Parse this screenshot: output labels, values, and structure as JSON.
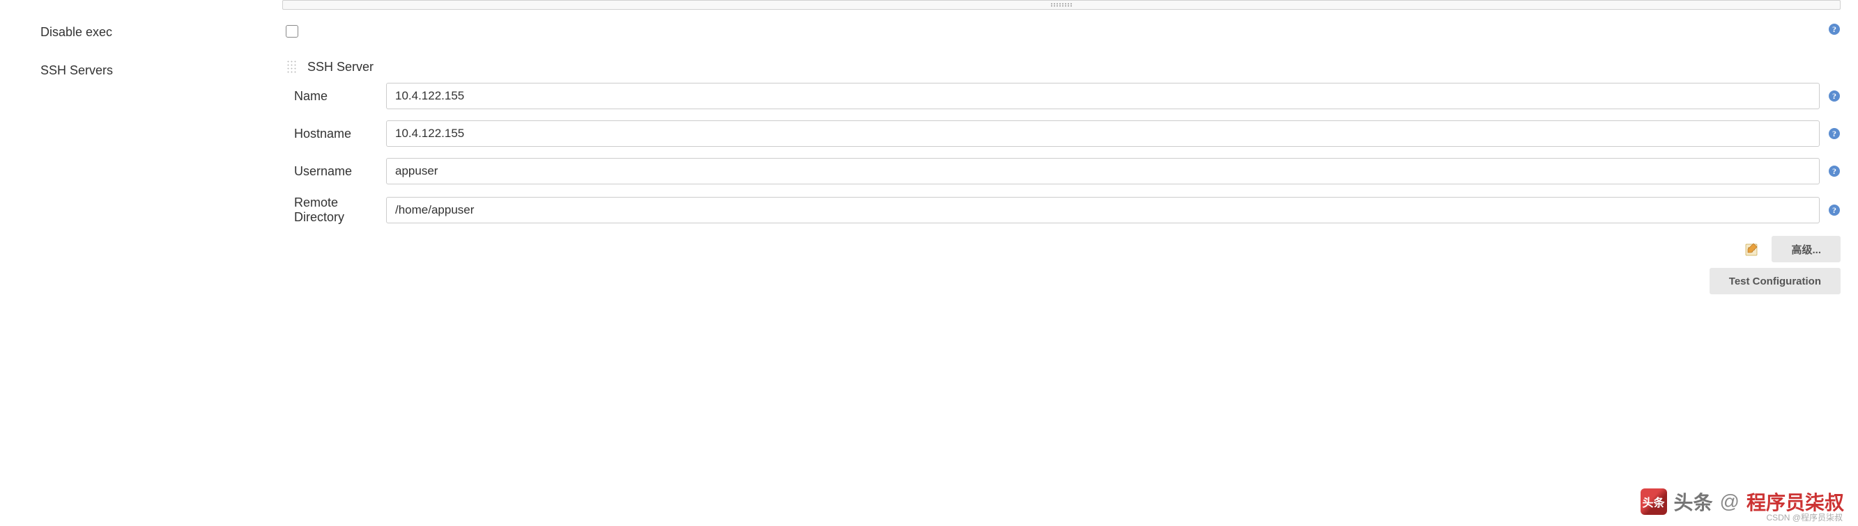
{
  "labels": {
    "disable_exec": "Disable exec",
    "ssh_servers": "SSH Servers"
  },
  "ssh_server": {
    "title": "SSH Server",
    "fields": {
      "name": {
        "label": "Name",
        "value": "10.4.122.155"
      },
      "hostname": {
        "label": "Hostname",
        "value": "10.4.122.155"
      },
      "username": {
        "label": "Username",
        "value": "appuser"
      },
      "remote_directory": {
        "label": "Remote Directory",
        "value": "/home/appuser"
      }
    }
  },
  "buttons": {
    "advanced": "高级...",
    "test_configuration": "Test Configuration"
  },
  "watermark": {
    "prefix": "头条",
    "at": "@",
    "author": "程序员柒叔",
    "sub": "CSDN @程序员柒叔"
  },
  "colors": {
    "help_icon": "#4a7cc4",
    "button_bg": "#e8e8e8",
    "input_border": "#cccccc"
  }
}
